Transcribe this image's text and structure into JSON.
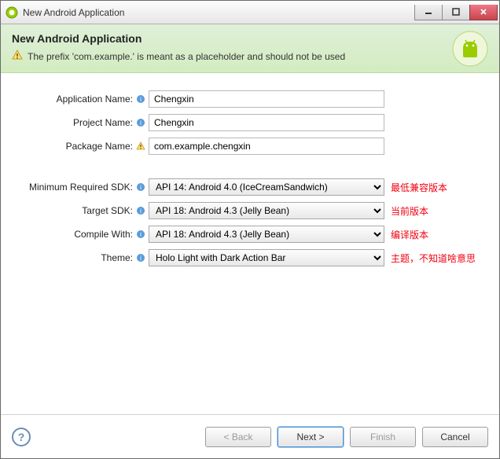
{
  "window": {
    "title": "New Android Application"
  },
  "header": {
    "title": "New Android Application",
    "warning": "The prefix 'com.example.' is meant as a placeholder and should not be used"
  },
  "form": {
    "app_name": {
      "label": "Application Name:",
      "value": "Chengxin"
    },
    "project_name": {
      "label": "Project Name:",
      "value": "Chengxin"
    },
    "package_name": {
      "label": "Package Name:",
      "value": "com.example.chengxin"
    },
    "min_sdk": {
      "label": "Minimum Required SDK:",
      "value": "API 14: Android 4.0 (IceCreamSandwich)",
      "annotation": "最低兼容版本"
    },
    "target_sdk": {
      "label": "Target SDK:",
      "value": "API 18: Android 4.3 (Jelly Bean)",
      "annotation": "当前版本"
    },
    "compile_with": {
      "label": "Compile With:",
      "value": "API 18: Android 4.3 (Jelly Bean)",
      "annotation": "编译版本"
    },
    "theme": {
      "label": "Theme:",
      "value": "Holo Light with Dark Action Bar",
      "annotation": "主题，不知道啥意思"
    }
  },
  "footer": {
    "back": "< Back",
    "next": "Next >",
    "finish": "Finish",
    "cancel": "Cancel"
  },
  "icons": {
    "info_color": "#3b78b5",
    "warn_color": "#d9a12a",
    "android_green": "#9acc00"
  }
}
